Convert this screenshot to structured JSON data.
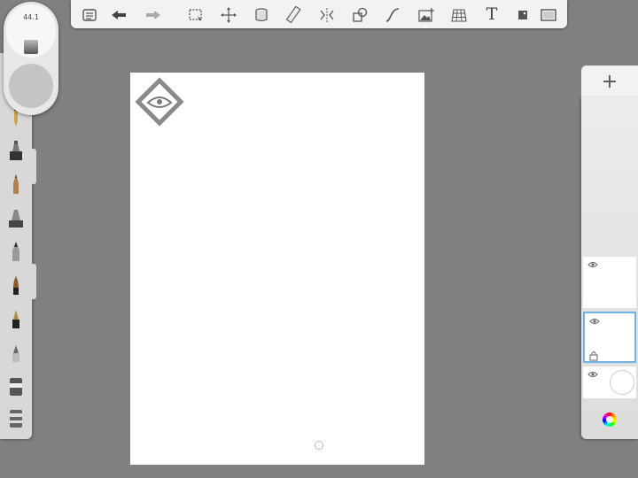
{
  "puck": {
    "size_value": "44.1"
  },
  "toolbar": {
    "tools": [
      "menu-icon",
      "undo-icon",
      "redo-icon",
      "selection-icon",
      "transform-icon",
      "fill-icon",
      "ruler-icon",
      "symmetry-icon",
      "shapes-icon",
      "stroke-icon",
      "image-icon",
      "perspective-icon",
      "text-icon",
      "crop-icon",
      "fullscreen-icon"
    ],
    "text_tool_label": "T"
  },
  "layers": {
    "add_label": "+"
  },
  "colors": {
    "background": "#808080",
    "canvas": "#ffffff",
    "panel": "#f2f2f2",
    "selection_accent": "#6fb3e0"
  }
}
